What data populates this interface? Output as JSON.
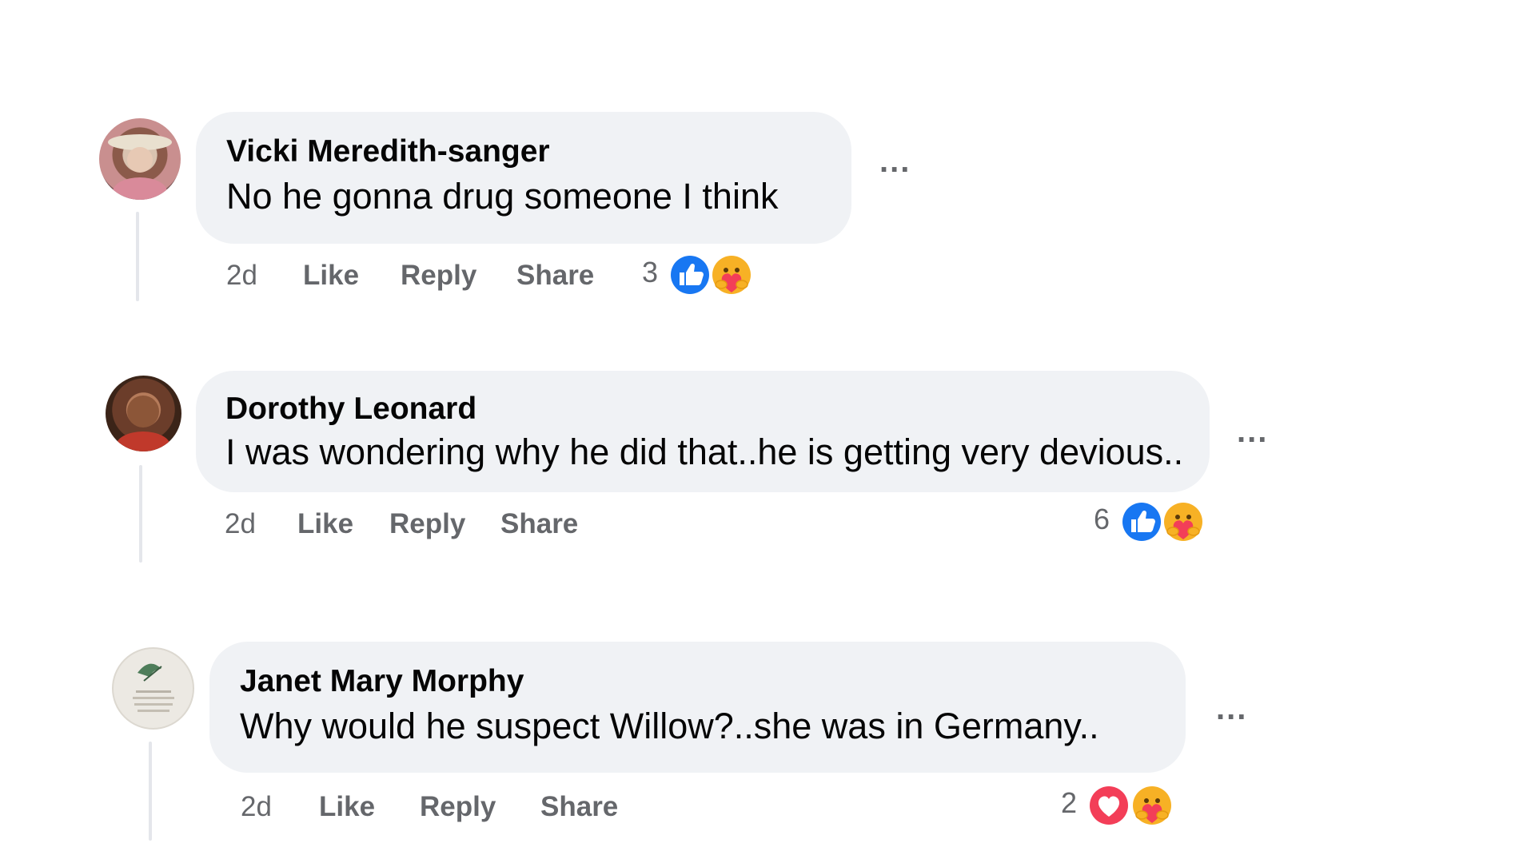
{
  "colors": {
    "bubble": "#f0f2f5",
    "secondary_text": "#65676b",
    "like_blue": "#1877f2",
    "love_red": "#f33e58",
    "care_yellow": "#f7b125"
  },
  "comments": [
    {
      "author": "Vicki Meredith-sanger",
      "text": "No he gonna drug someone I think",
      "time": "2d",
      "like_label": "Like",
      "reply_label": "Reply",
      "share_label": "Share",
      "reaction_count": "3",
      "reactions": [
        "like-icon",
        "care-icon"
      ],
      "more_label": "..."
    },
    {
      "author": "Dorothy Leonard",
      "text": "I was wondering why he did that..he is getting very devious..",
      "time": "2d",
      "like_label": "Like",
      "reply_label": "Reply",
      "share_label": "Share",
      "reaction_count": "6",
      "reactions": [
        "like-icon",
        "care-icon"
      ],
      "more_label": "..."
    },
    {
      "author": "Janet Mary Morphy",
      "text": "Why would he suspect Willow?..she was in Germany..",
      "time": "2d",
      "like_label": "Like",
      "reply_label": "Reply",
      "share_label": "Share",
      "reaction_count": "2",
      "reactions": [
        "love-icon",
        "care-icon"
      ],
      "more_label": "..."
    }
  ]
}
